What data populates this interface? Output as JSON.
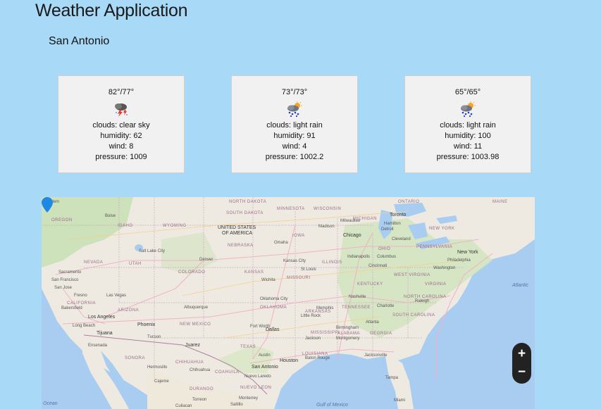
{
  "header": {
    "title": "Weather Application"
  },
  "location": {
    "city": "San Antonio"
  },
  "forecast": [
    {
      "temp": "82°/77°",
      "icon": "thunderstorm-icon",
      "clouds": "clouds: clear sky",
      "humidity": "humidity: 62",
      "wind": "wind: 8",
      "pressure": "pressure: 1009"
    },
    {
      "temp": "73°/73°",
      "icon": "rain-sun-icon",
      "clouds": "clouds: light rain",
      "humidity": "humidity: 91",
      "wind": "wind: 4",
      "pressure": "pressure: 1002.2"
    },
    {
      "temp": "65°/65°",
      "icon": "rain-sun-icon",
      "clouds": "clouds: light rain",
      "humidity": "humidity: 100",
      "wind": "wind: 11",
      "pressure": "pressure: 1003.98"
    }
  ],
  "map": {
    "zoom_in": "+",
    "zoom_out": "−",
    "country": [
      "UNITED STATES",
      "OF AMERICA"
    ],
    "cities": [
      "Salem",
      "Boise",
      "Toronto",
      "Milwaukee",
      "Detroit",
      "Cleveland",
      "Chicago",
      "Madison",
      "Hamilton",
      "New York",
      "Philadelphia",
      "Washington",
      "Omaha",
      "Denver",
      "Salt Lake City",
      "Sacramento",
      "San Francisco",
      "San Jose",
      "Fresno",
      "Las Vegas",
      "Bakersfield",
      "Los Angeles",
      "Long Beach",
      "Tijuana",
      "Ensenada",
      "Phoenix",
      "Tucson",
      "Albuquerque",
      "Wichita",
      "Kansas City",
      "St Louis",
      "Indianapolis",
      "Columbus",
      "Cincinnati",
      "Nashville",
      "Charlotte",
      "Raleigh",
      "Oklahoma City",
      "Fort Worth",
      "Dallas",
      "Austin",
      "Houston",
      "San Antonio",
      "Memphis",
      "Atlanta",
      "Birmingham",
      "Jackson",
      "Montgomery",
      "Jacksonville",
      "Baton Rouge",
      "Tampa",
      "Miami",
      "Hermosillo",
      "Chihuahua",
      "Juarez",
      "Nuevo Laredo",
      "Monterrey",
      "Saltillo",
      "Torreon",
      "Culiacan",
      "Cajeme",
      "Little Rock"
    ],
    "regions": [
      "WYOMING",
      "NEBRASKA",
      "NEVADA",
      "UTAH",
      "COLORADO",
      "KANSAS",
      "MISSOURI",
      "ILLINOIS",
      "OHIO",
      "PENNSYLVANIA",
      "NEW YORK",
      "MICHIGAN",
      "WISCONSIN",
      "IOWA",
      "ONTARIO",
      "CALIFORNIA",
      "ARIZONA",
      "NEW MEXICO",
      "TEXAS",
      "OKLAHOMA",
      "ARKANSAS",
      "MISSISSIPPI",
      "ALABAMA",
      "GEORGIA",
      "TENNESSEE",
      "KENTUCKY",
      "VIRGINIA",
      "WEST VIRGINIA",
      "NORTH CAROLINA",
      "SOUTH CAROLINA",
      "LOUISIANA",
      "IDAHO",
      "OREGON",
      "SONORA",
      "CHIHUAHUA",
      "COAHUILA",
      "NUEVO LEON",
      "DURANGO",
      "SOUTH DAKOTA",
      "NORTH DAKOTA",
      "MINNESOTA",
      "MAINE"
    ],
    "oceans": [
      "Atlantic",
      "Gulf of Mexico",
      "Ocean"
    ],
    "marker": "location-pin-icon"
  }
}
